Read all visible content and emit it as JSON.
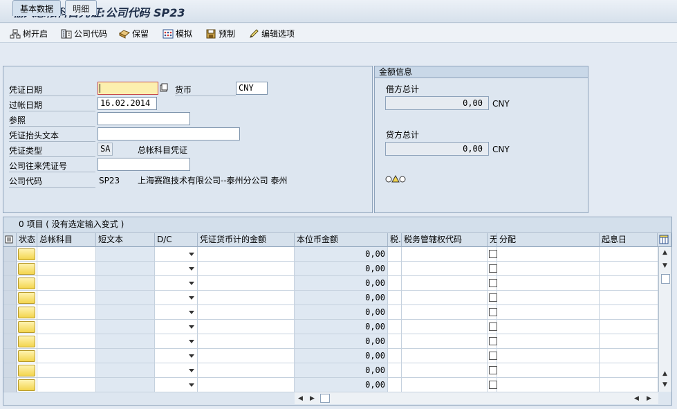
{
  "window": {
    "title": "输入总帐科目凭证:公司代码 SP23"
  },
  "toolbar": {
    "tree_label": "树开启",
    "company_code_label": "公司代码",
    "park_label": "保留",
    "simulate_label": "模拟",
    "preenter_label": "预制",
    "edit_options_label": "编辑选项"
  },
  "tabs": [
    {
      "label": "基本数据",
      "active": true
    },
    {
      "label": "明细",
      "active": false
    }
  ],
  "header": {
    "doc_date_label": "凭证日期",
    "doc_date_value": "",
    "currency_label": "货币",
    "currency_value": "CNY",
    "posting_date_label": "过帐日期",
    "posting_date_value": "16.02.2014",
    "reference_label": "参照",
    "reference_value": "",
    "header_text_label": "凭证抬头文本",
    "header_text_value": "",
    "doc_type_label": "凭证类型",
    "doc_type_value": "SA",
    "doc_type_desc": "总帐科目凭证",
    "intercompany_label": "公司往来凭证号",
    "intercompany_value": "",
    "company_code_label": "公司代码",
    "company_code_value": "SP23",
    "company_code_desc": "上海赛跑技术有限公司--泰州分公司 泰州"
  },
  "amount_info": {
    "title": "金额信息",
    "debit_label": "借方总计",
    "debit_value": "0,00",
    "debit_currency": "CNY",
    "credit_label": "贷方总计",
    "credit_value": "0,00",
    "credit_currency": "CNY",
    "balance_status": "traffic-light-yellow"
  },
  "grid": {
    "title": "0 项目 ( 没有选定输入变式 )",
    "columns": [
      "状态",
      "总帐科目",
      "短文本",
      "D/C",
      "凭证货币计的金额",
      "本位币金额",
      "税.",
      "税务管辖权代码",
      "无",
      "分配",
      "起息日"
    ],
    "rows": [
      {
        "local_amount": "0,00"
      },
      {
        "local_amount": "0,00"
      },
      {
        "local_amount": "0,00"
      },
      {
        "local_amount": "0,00"
      },
      {
        "local_amount": "0,00"
      },
      {
        "local_amount": "0,00"
      },
      {
        "local_amount": "0,00"
      },
      {
        "local_amount": "0,00"
      },
      {
        "local_amount": "0,00"
      },
      {
        "local_amount": "0,00"
      }
    ]
  },
  "colors": {
    "status_yellow": "#f3d54e",
    "panel_bg": "#dde6f0",
    "accent_red": "#d03030"
  }
}
